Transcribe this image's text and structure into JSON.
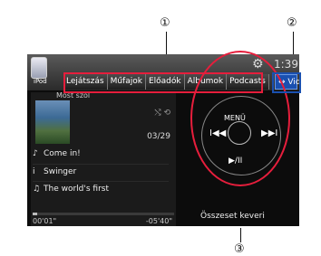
{
  "callouts": {
    "c1": "①",
    "c2": "②",
    "c3": "③"
  },
  "topbar": {
    "ipod_label": "iPod",
    "gear_icon": "gear-icon",
    "clock": "1:39",
    "tabs": [
      "Lejátszás",
      "Műfajok",
      "Előadók",
      "Albumok",
      "Podcasts"
    ],
    "video_label": "↔ Videó"
  },
  "player": {
    "mode": "Most szól",
    "track_counter": "03/29",
    "song": "Come in!",
    "artist": "Swinger",
    "album": "The world's first",
    "elapsed": "00'01\"",
    "remaining": "-05'40\"",
    "progress": 0.03
  },
  "controls": {
    "menu_label": "MENÜ",
    "prev_label": "I◀◀",
    "next_label": "▶▶I",
    "play_label": "▶/II",
    "random_label": "Összeset keveri"
  },
  "colors": {
    "highlight_red": "#e61e3c",
    "highlight_blue": "#1a50b0"
  }
}
